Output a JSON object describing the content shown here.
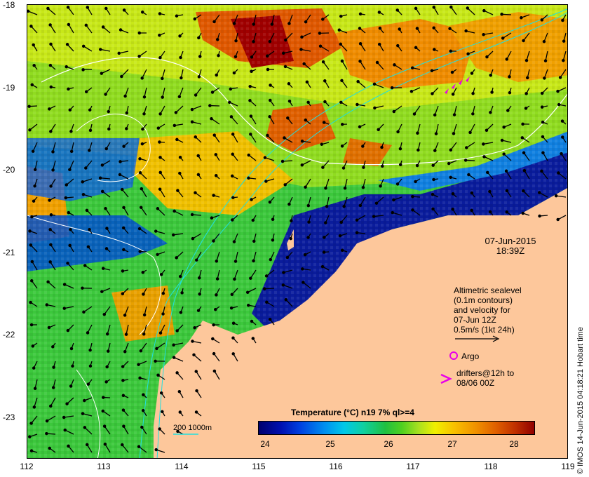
{
  "axes": {
    "y_ticks": [
      "-18",
      "-19",
      "-20",
      "-21",
      "-22",
      "-23"
    ],
    "x_ticks": [
      "112",
      "113",
      "114",
      "115",
      "116",
      "117",
      "118",
      "119"
    ]
  },
  "overlay": {
    "date": "07-Jun-2015",
    "time": "18:39Z",
    "altimetry_lines": [
      "Altimetric sealevel",
      "(0.1m contours)",
      "and velocity for",
      "07-Jun 12Z",
      "0.5m/s (1kt 24h)"
    ],
    "argo_label": "Argo",
    "drifters_lines": [
      "drifters@12h to",
      "08/06 00Z"
    ],
    "bathymetry_label": "200  1000m"
  },
  "legend": {
    "title": "Temperature (°C) n19 7% ql>=4",
    "labels": [
      "24",
      "25",
      "26",
      "27",
      "28"
    ]
  },
  "credit": "© IMOS 14-Jun-2015 04:18:21 Hobart time",
  "colors": {
    "land": "#fdc79b",
    "argo_marker": "#e800e8",
    "drifter_marker": "#e800e8",
    "contour": "#ffffff",
    "bathymetry": "#20e0e0"
  }
}
